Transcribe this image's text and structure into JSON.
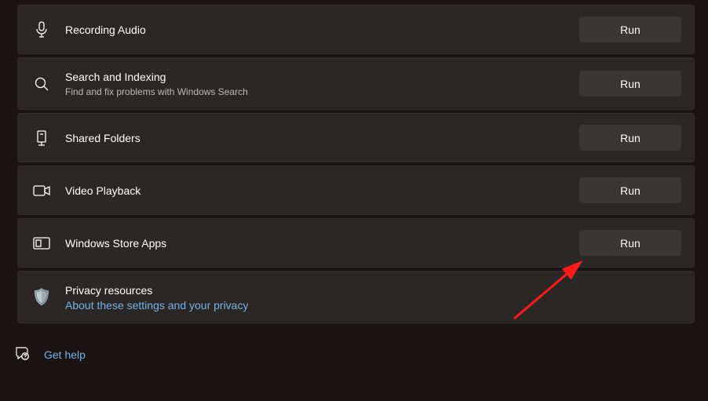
{
  "troubleshooters": [
    {
      "key": "recording-audio",
      "title": "Recording Audio",
      "subtitle": null,
      "button_label": "Run",
      "icon": "microphone"
    },
    {
      "key": "search-indexing",
      "title": "Search and Indexing",
      "subtitle": "Find and fix problems with Windows Search",
      "button_label": "Run",
      "icon": "search"
    },
    {
      "key": "shared-folders",
      "title": "Shared Folders",
      "subtitle": null,
      "button_label": "Run",
      "icon": "shared-folder"
    },
    {
      "key": "video-playback",
      "title": "Video Playback",
      "subtitle": null,
      "button_label": "Run",
      "icon": "video"
    },
    {
      "key": "windows-store-apps",
      "title": "Windows Store Apps",
      "subtitle": null,
      "button_label": "Run",
      "icon": "store"
    }
  ],
  "privacy": {
    "title": "Privacy resources",
    "link_label": "About these settings and your privacy",
    "icon": "shield"
  },
  "help": {
    "label": "Get help",
    "icon": "help"
  },
  "colors": {
    "accent_link": "#74b2e8",
    "card_bg": "#2b2724",
    "page_bg": "#1a1513",
    "button_bg": "#3a3633"
  }
}
